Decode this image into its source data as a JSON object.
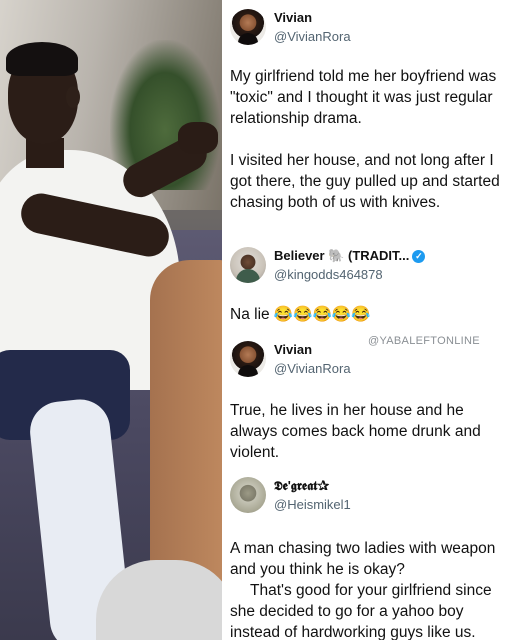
{
  "tweets": [
    {
      "name": "Vivian",
      "handle": "@VivianRora",
      "text": "My girlfriend told me her boyfriend was \"toxic\" and I thought it was just regular relationship drama.",
      "text2": "I visited her house, and not long after I got there, the guy pulled up and started chasing both of us with knives."
    },
    {
      "name": "Believer 🐘 (TRADIT...",
      "handle": "@kingodds464878",
      "verified": true,
      "text": "Na lie 😂😂😂😂😂"
    },
    {
      "name": "Vivian",
      "handle": "@VivianRora",
      "text": "True, he lives in her house and he always comes back home drunk and violent."
    },
    {
      "name": "𝕯𝖊'𝖌𝖗𝖊𝖆𝖙✰",
      "handle": "@Heismikel1",
      "text": "A man chasing two ladies with weapon and you think he is okay?",
      "text2": "That's good for your girlfriend since she decided to go for a yahoo boy instead of hardworking guys like us."
    }
  ],
  "watermark": "@YABALEFTONLINE",
  "colors": {
    "handle": "#536471",
    "verified": "#1d9bf0",
    "text": "#111111"
  }
}
